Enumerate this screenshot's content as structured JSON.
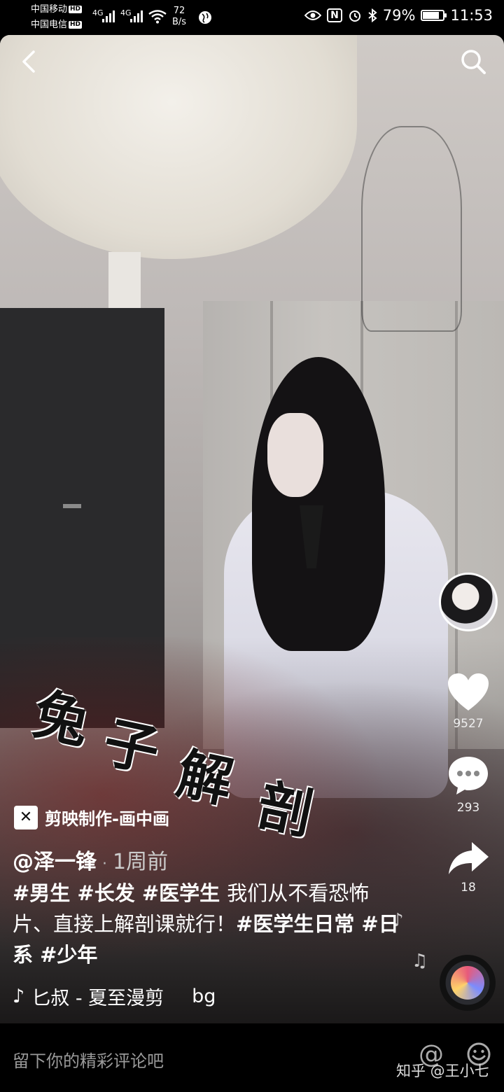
{
  "status_bar": {
    "carrier1": "中国移动",
    "carrier2": "中国电信",
    "hd_label": "HD",
    "signal1": "4G",
    "signal2": "4G",
    "net_speed_value": "72",
    "net_speed_unit": "B/s",
    "nfc_label": "N",
    "battery": "79%",
    "battery_level": 0.79,
    "time": "11:53"
  },
  "video": {
    "title_overlay": [
      "兔",
      "子",
      "解",
      "剖"
    ]
  },
  "rail": {
    "likes": "9527",
    "comments": "293",
    "shares": "18"
  },
  "info": {
    "capcut_label": "剪映制作-画中画",
    "author": "@泽一锋",
    "time_ago": "1周前",
    "description_parts": [
      {
        "text": "#男生 ",
        "tag": true
      },
      {
        "text": "#长发 ",
        "tag": true
      },
      {
        "text": "#医学生 ",
        "tag": true
      },
      {
        "text": "我们从不看恐怖片、直接上解剖课就行！",
        "tag": false
      },
      {
        "text": "#医学生日常 ",
        "tag": true
      },
      {
        "text": "#日系 ",
        "tag": true
      },
      {
        "text": "#少年",
        "tag": true
      }
    ],
    "music_title": "匕叔 - 夏至漫剪",
    "music_extra": "bg"
  },
  "comment_bar": {
    "placeholder": "留下你的精彩评论吧",
    "at_symbol": "@",
    "watermark": "知乎 @王小七"
  },
  "icons": {
    "back": "chevron-left-icon",
    "search": "search-icon",
    "like": "heart-icon",
    "comment": "comment-bubble-icon",
    "share": "share-arrow-icon",
    "emoji": "smiley-icon"
  }
}
